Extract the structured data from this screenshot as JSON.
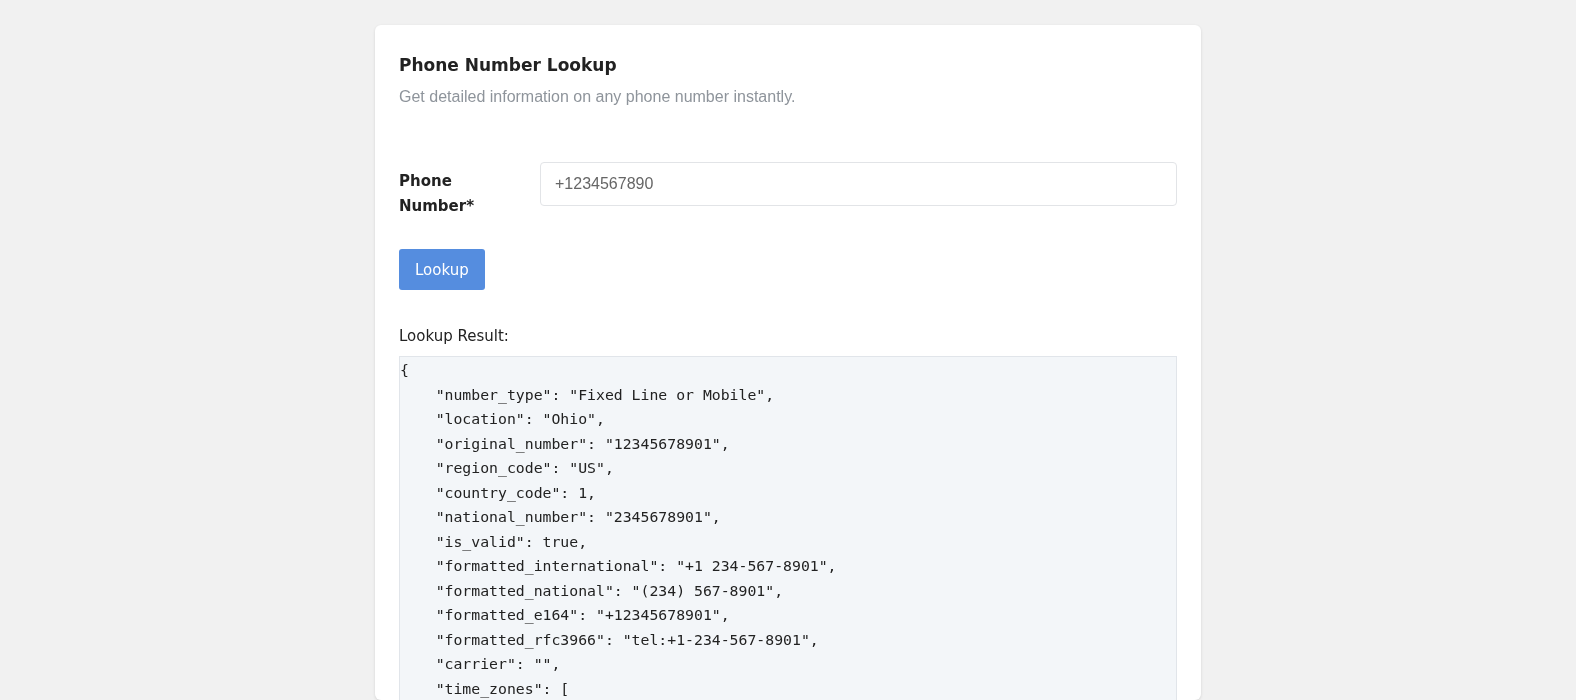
{
  "card": {
    "title": "Phone Number Lookup",
    "subtitle": "Get detailed information on any phone number instantly."
  },
  "form": {
    "label": "Phone Number*",
    "placeholder": "+1234567890",
    "button": "Lookup"
  },
  "result": {
    "label": "Lookup Result:",
    "lines": [
      "{",
      "    \"number_type\": \"Fixed Line or Mobile\",",
      "    \"location\": \"Ohio\",",
      "    \"original_number\": \"12345678901\",",
      "    \"region_code\": \"US\",",
      "    \"country_code\": 1,",
      "    \"national_number\": \"2345678901\",",
      "    \"is_valid\": true,",
      "    \"formatted_international\": \"+1 234-567-8901\",",
      "    \"formatted_national\": \"(234) 567-8901\",",
      "    \"formatted_e164\": \"+12345678901\",",
      "    \"formatted_rfc3966\": \"tel:+1-234-567-8901\",",
      "    \"carrier\": \"\",",
      "    \"time_zones\": ["
    ]
  }
}
